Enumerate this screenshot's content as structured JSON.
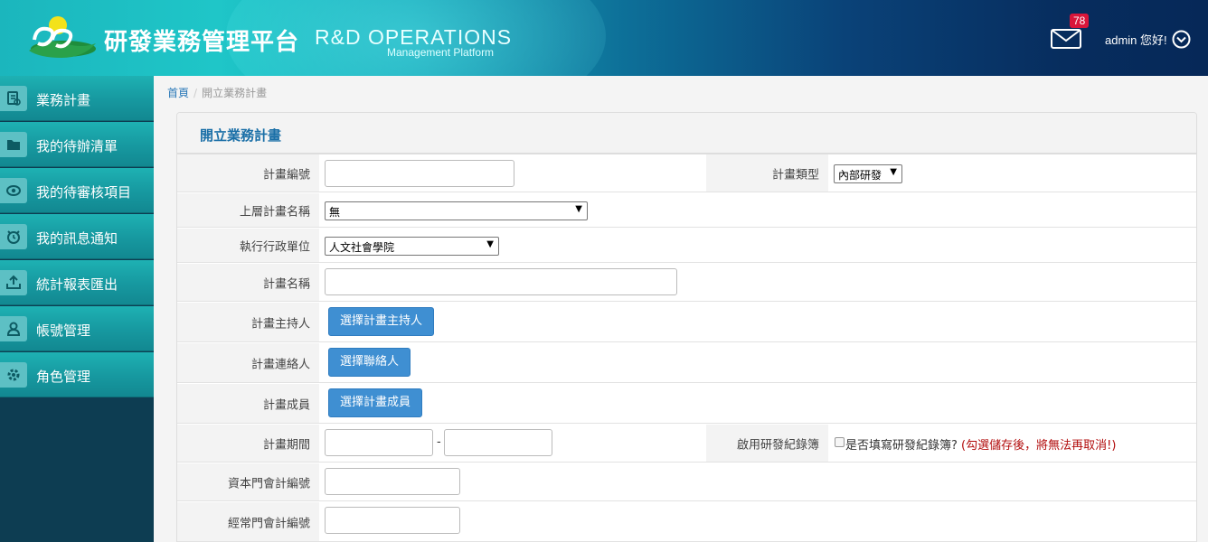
{
  "header": {
    "brand_cn": "研發業務管理平台",
    "brand_en": "R&D OPERATIONS",
    "brand_sub": "Management Platform",
    "mail_count": "78",
    "user_greeting": "admin 您好!"
  },
  "sidebar": {
    "items": [
      {
        "label": "業務計畫",
        "icon": "plan-icon"
      },
      {
        "label": "我的待辦清單",
        "icon": "folder-icon"
      },
      {
        "label": "我的待審核項目",
        "icon": "eye-icon"
      },
      {
        "label": "我的訊息通知",
        "icon": "alarm-clock-icon"
      },
      {
        "label": "統計報表匯出",
        "icon": "export-icon"
      },
      {
        "label": "帳號管理",
        "icon": "users-icon"
      },
      {
        "label": "角色管理",
        "icon": "gear-icon"
      }
    ]
  },
  "breadcrumb": {
    "home": "首頁",
    "current": "開立業務計畫"
  },
  "form": {
    "title": "開立業務計畫",
    "plan_no_label": "計畫編號",
    "plan_type_label": "計畫類型",
    "plan_type_value": "內部研發",
    "parent_label": "上層計畫名稱",
    "parent_value": "無",
    "unit_label": "執行行政單位",
    "unit_value": "人文社會學院",
    "name_label": "計畫名稱",
    "host_label": "計畫主持人",
    "host_button": "選擇計畫主持人",
    "contact_label": "計畫連絡人",
    "contact_button": "選擇聯絡人",
    "member_label": "計畫成員",
    "member_button": "選擇計畫成員",
    "period_label": "計畫期間",
    "period_sep": "-",
    "notebook_label": "啟用研發紀錄簿",
    "notebook_check_text": "是否填寫研發紀錄簿?",
    "notebook_warning": "(勾選儲存後，將無法再取消!)",
    "capital_label": "資本門會計編號",
    "recurrent_label": "經常門會計編號"
  }
}
